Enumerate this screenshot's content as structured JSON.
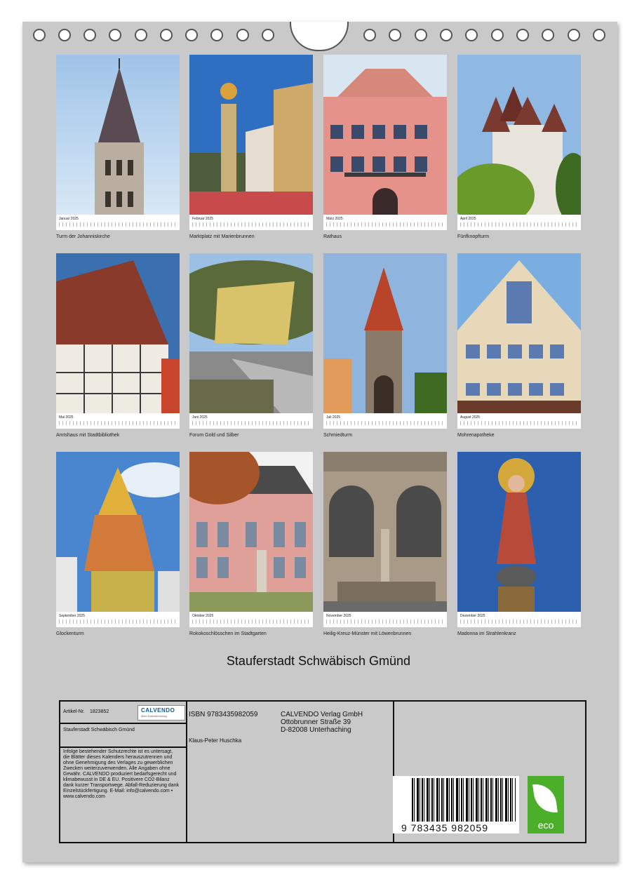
{
  "months": [
    {
      "label": "Januar 2025",
      "caption": "Turm der Johanniskirche"
    },
    {
      "label": "Februar 2025",
      "caption": "Marktplatz mit Marienbrunnen"
    },
    {
      "label": "März 2025",
      "caption": "Rathaus"
    },
    {
      "label": "April 2025",
      "caption": "Fünfknopfturm"
    },
    {
      "label": "Mai 2025",
      "caption": "Amtshaus mit Stadtbibliothek"
    },
    {
      "label": "Juni 2025",
      "caption": "Forum Gold und Silber"
    },
    {
      "label": "Juli 2025",
      "caption": "Schmiedturm"
    },
    {
      "label": "August 2025",
      "caption": "Mohrenapotheke"
    },
    {
      "label": "September 2025",
      "caption": "Glockenturm"
    },
    {
      "label": "Oktober 2025",
      "caption": "Rokokoschlösschen im Stadtgarten"
    },
    {
      "label": "November 2025",
      "caption": "Heilig-Kreuz-Münster mit Löwenbrunnen"
    },
    {
      "label": "Dezember 2025",
      "caption": "Madonna im Strahlenkranz"
    }
  ],
  "title": "Stauferstadt Schwäbisch Gmünd",
  "footer": {
    "article_label": "Artikel-Nr.",
    "article_no": "1823852",
    "logo_text": "CALVENDO",
    "logo_sub": "Mein Kalenderverlag",
    "product_title": "Stauferstadt Schwäbisch Gmünd",
    "legal": "Infolge bestehender Schutzrechte ist es untersagt, die Blätter dieses Kalenders herauszutrennen und ohne Genehmigung des Verlages zu gewerblichen Zwecken weiterzuverwenden. Alle Angaben ohne Gewähr. CALVENDO produziert bedarfsgerecht und klimabewusst in DE & EU. Positivere CO2-Bilanz dank kurzer Transportwege. Abfall-Reduzierung dank Einzelstückfertigung. E-Mail: info@calvendo.com • www.calvendo.com",
    "isbn": "ISBN 9783435982059",
    "author": "Klaus-Peter Huschka",
    "publisher_lines": [
      "CALVENDO Verlag GmbH",
      "Ottobrunner Straße 39",
      "D-82008 Unterhaching"
    ],
    "barcode_number": "9   783435   982059",
    "eco_label": "eco"
  }
}
